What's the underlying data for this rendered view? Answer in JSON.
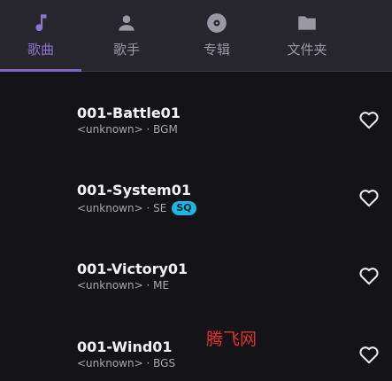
{
  "tabs": [
    {
      "label": "歌曲",
      "icon": "music-note-icon",
      "active": true
    },
    {
      "label": "歌手",
      "icon": "person-icon",
      "active": false
    },
    {
      "label": "专辑",
      "icon": "disc-icon",
      "active": false
    },
    {
      "label": "文件夹",
      "icon": "folder-icon",
      "active": false
    }
  ],
  "songs": [
    {
      "title": "001-Battle01",
      "artist": "<unknown>",
      "separator": "·",
      "album": "BGM",
      "badge": ""
    },
    {
      "title": "001-System01",
      "artist": "<unknown>",
      "separator": "·",
      "album": "SE",
      "badge": "SQ"
    },
    {
      "title": "001-Victory01",
      "artist": "<unknown>",
      "separator": "·",
      "album": "ME",
      "badge": ""
    },
    {
      "title": "001-Wind01",
      "artist": "<unknown>",
      "separator": "·",
      "album": "BGS",
      "badge": ""
    }
  ],
  "watermark": "腾飞网",
  "colors": {
    "accent": "#8e74c9",
    "badge": "#1fb3e0",
    "watermark": "#e0322d"
  }
}
